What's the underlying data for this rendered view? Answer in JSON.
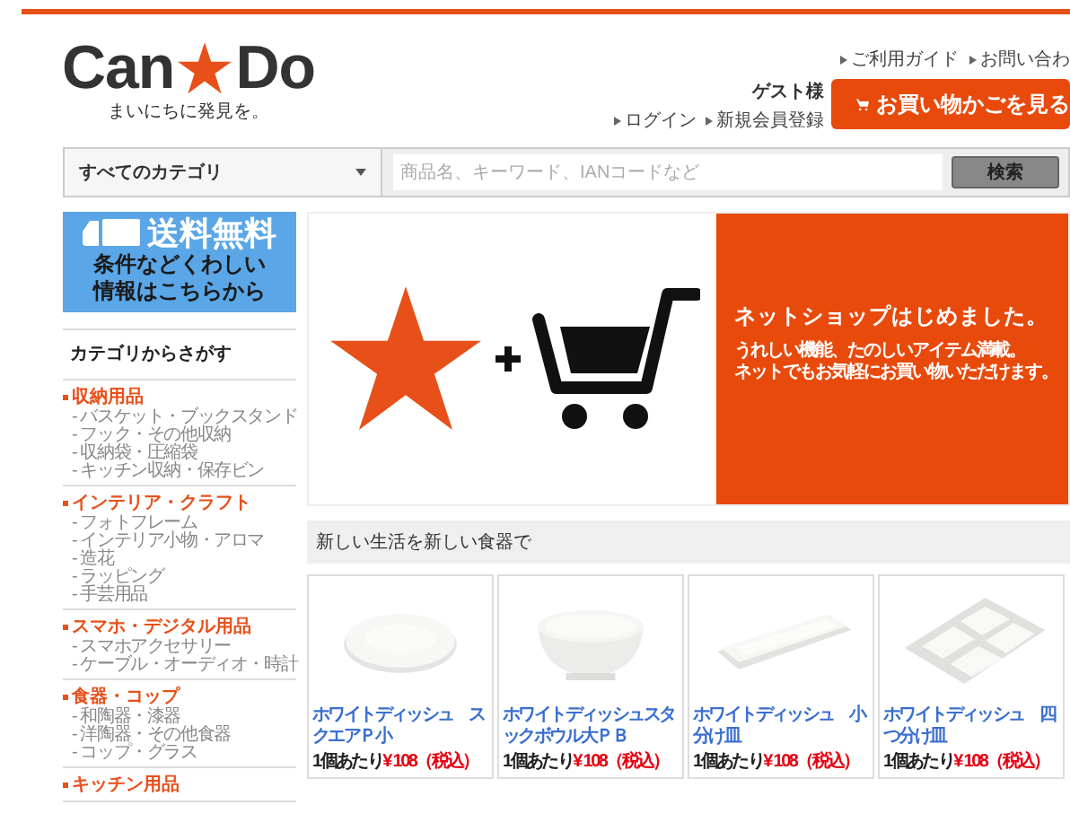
{
  "top_links": [
    {
      "label": "ご利用ガイド"
    },
    {
      "label": "お問い合わ"
    }
  ],
  "logo": {
    "left": "Can",
    "right": "Do",
    "tagline": "まいにちに発見を。"
  },
  "guest": "ゲスト様",
  "account_links": [
    {
      "label": "ログイン"
    },
    {
      "label": "新規会員登録"
    }
  ],
  "cart_button": "お買い物かごを見る",
  "search": {
    "category": "すべてのカテゴリ",
    "placeholder": "商品名、キーワード、IANコードなど",
    "button": "検索"
  },
  "shipping_banner": {
    "title": "送料無料",
    "lines": [
      "条件などくわしい",
      "情報はこちらから"
    ]
  },
  "sidebar": {
    "heading": "カテゴリからさがす",
    "categories": [
      {
        "label": "収納用品",
        "children": [
          {
            "label": "- バスケット・ブックスタンド"
          },
          {
            "label": "- フック・その他収納"
          },
          {
            "label": "- 収納袋・圧縮袋"
          },
          {
            "label": "- キッチン収納・保存ビン"
          }
        ]
      },
      {
        "label": "インテリア・クラフト",
        "children": [
          {
            "label": "- フォトフレーム"
          },
          {
            "label": "- インテリア小物・アロマ"
          },
          {
            "label": "- 造花"
          },
          {
            "label": "- ラッピング"
          },
          {
            "label": "- 手芸用品"
          }
        ]
      },
      {
        "label": "スマホ・デジタル用品",
        "children": [
          {
            "label": "- スマホアクセサリー"
          },
          {
            "label": "- ケーブル・オーディオ・時計"
          }
        ]
      },
      {
        "label": "食器・コップ",
        "children": [
          {
            "label": "- 和陶器・漆器"
          },
          {
            "label": "- 洋陶器・その他食器"
          },
          {
            "label": "- コップ・グラス"
          }
        ]
      },
      {
        "label": "キッチン用品"
      }
    ]
  },
  "hero": {
    "heading": "ネットショップはじめました。",
    "lines": [
      "うれしい機能、たのしいアイテム満載。",
      "ネットでもお気軽にお買い物いただけます。"
    ]
  },
  "section_title": "新しい生活を新しい食器で",
  "products": [
    {
      "name": "ホワイトディッシュ　スクエアＰ小",
      "unit": "1個あたり",
      "price": "¥ 108（税込）"
    },
    {
      "name": "ホワイトディッシュスタックボウル大ＰＢ",
      "unit": "1個あたり",
      "price": "¥ 108（税込）"
    },
    {
      "name": "ホワイトディッシュ　小分け皿",
      "unit": "1個あたり",
      "price": "¥ 108（税込）"
    },
    {
      "name": "ホワイトディッシュ　四つ分け皿",
      "unit": "1個あたり",
      "price": "¥ 108（税込）"
    }
  ]
}
